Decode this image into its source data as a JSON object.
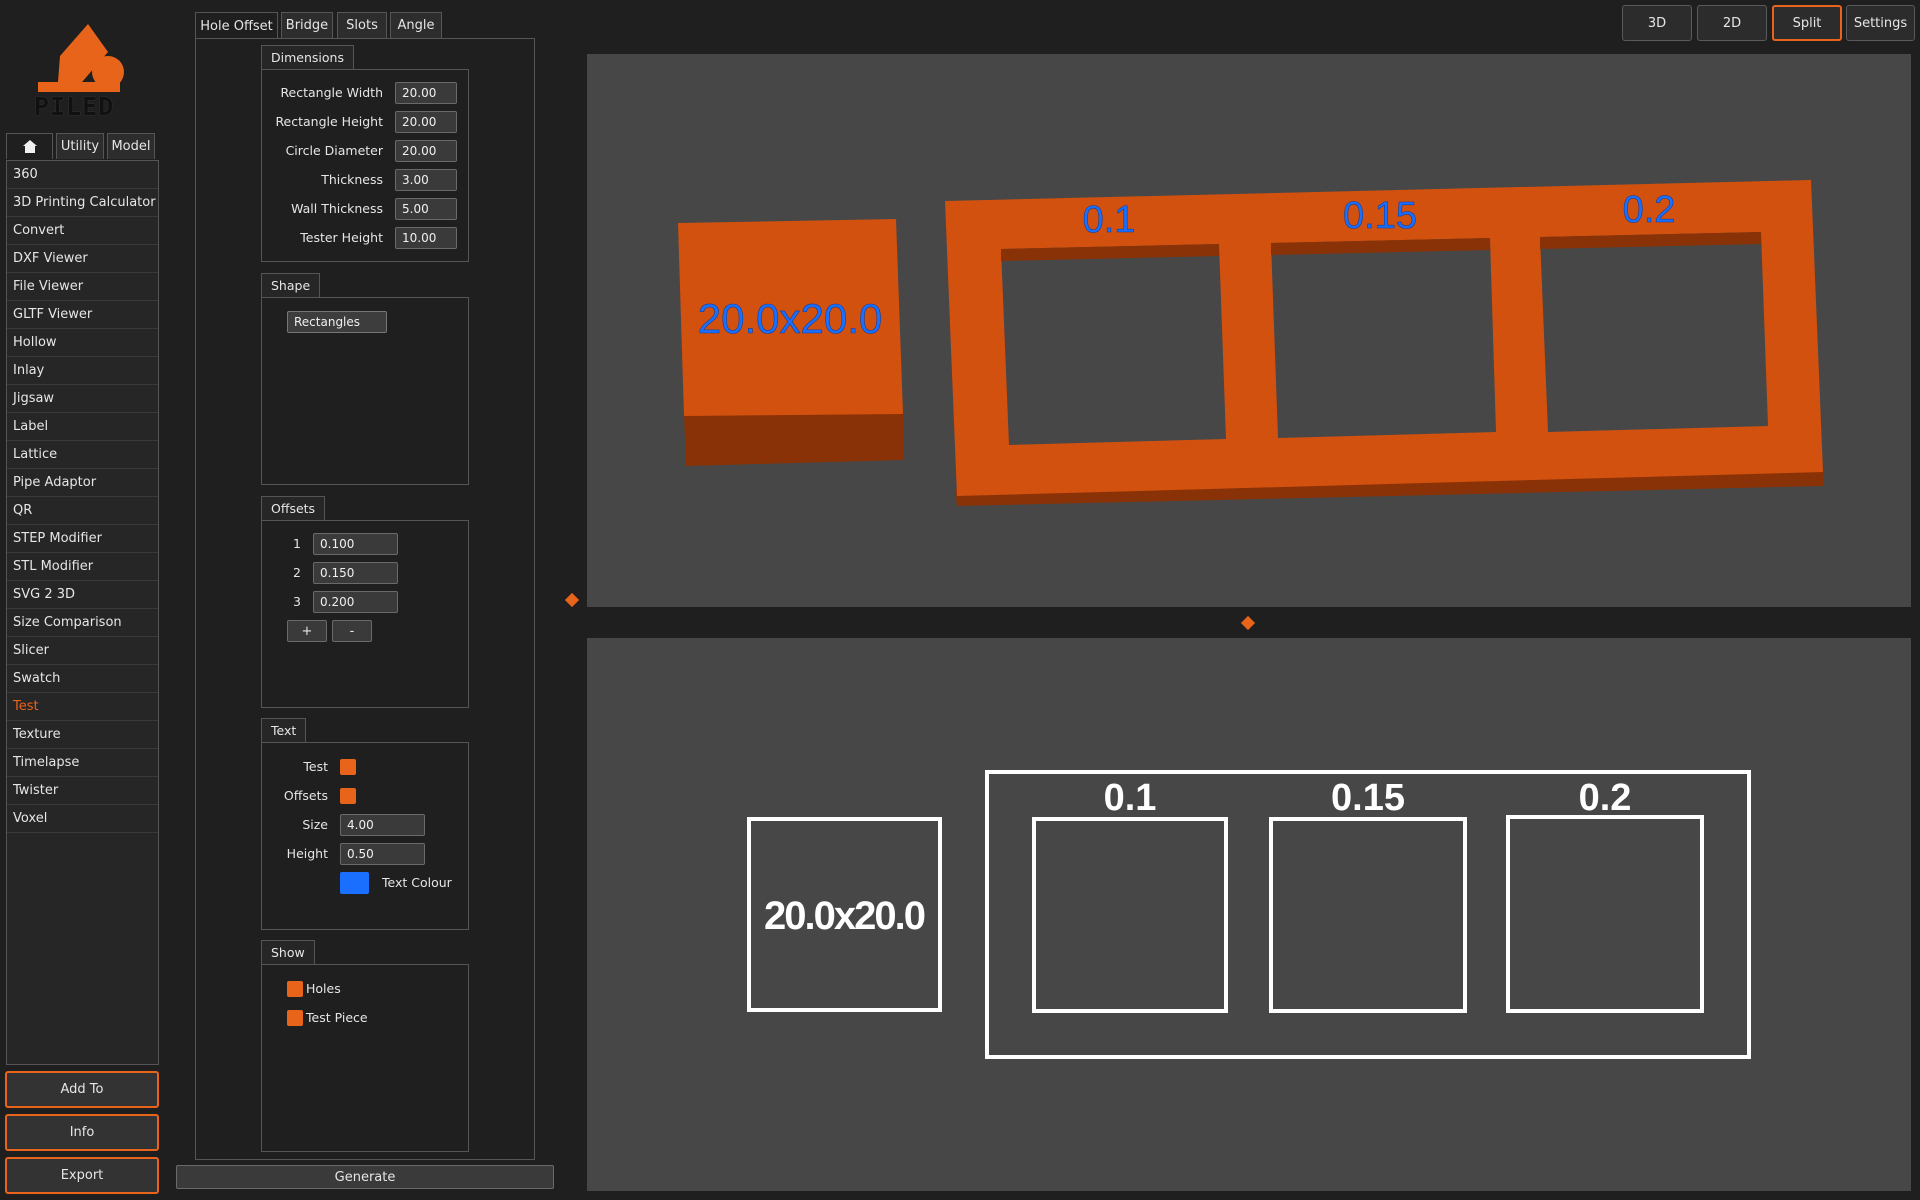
{
  "logo": {
    "text": "PILED",
    "color": "#e8641a"
  },
  "left_tabs": {
    "home_icon": "home-icon",
    "utility": "Utility",
    "model": "Model"
  },
  "nav": {
    "items": [
      "360",
      "3D Printing Calculator",
      "Convert",
      "DXF Viewer",
      "File Viewer",
      "GLTF Viewer",
      "Hollow",
      "Inlay",
      "Jigsaw",
      "Label",
      "Lattice",
      "Pipe Adaptor",
      "QR",
      "STEP Modifier",
      "STL Modifier",
      "SVG 2 3D",
      "Size Comparison",
      "Slicer",
      "Swatch",
      "Test",
      "Texture",
      "Timelapse",
      "Twister",
      "Voxel"
    ],
    "active": "Test"
  },
  "side_buttons": {
    "add_to": "Add To",
    "info": "Info",
    "export": "Export"
  },
  "main_tabs": [
    "Hole Offset",
    "Bridge",
    "Slots",
    "Angle"
  ],
  "dimensions": {
    "title": "Dimensions",
    "fields": [
      {
        "label": "Rectangle Width",
        "value": "20.00"
      },
      {
        "label": "Rectangle Height",
        "value": "20.00"
      },
      {
        "label": "Circle Diameter",
        "value": "20.00"
      },
      {
        "label": "Thickness",
        "value": "3.00"
      },
      {
        "label": "Wall Thickness",
        "value": "5.00"
      },
      {
        "label": "Tester Height",
        "value": "10.00"
      }
    ]
  },
  "shape": {
    "title": "Shape",
    "selected": "Rectangles"
  },
  "offsets": {
    "title": "Offsets",
    "rows": [
      {
        "index": "1",
        "value": "0.100"
      },
      {
        "index": "2",
        "value": "0.150"
      },
      {
        "index": "3",
        "value": "0.200"
      }
    ],
    "add_label": "+",
    "remove_label": "-"
  },
  "text": {
    "title": "Text",
    "test_label": "Test",
    "offsets_label": "Offsets",
    "size_label": "Size",
    "size_value": "4.00",
    "height_label": "Height",
    "height_value": "0.50",
    "colour_label": "Text Colour",
    "colour": "#1a6fff"
  },
  "show": {
    "title": "Show",
    "holes": "Holes",
    "test_piece": "Test Piece"
  },
  "generate_label": "Generate",
  "view_buttons": {
    "b3d": "3D",
    "b2d": "2D",
    "split": "Split",
    "settings": "Settings"
  },
  "scene": {
    "block_label": "20.0x20.0",
    "hole_labels": [
      "0.1",
      "0.15",
      "0.2"
    ],
    "accent": "#d2510f",
    "text_color": "#1a6fff"
  }
}
